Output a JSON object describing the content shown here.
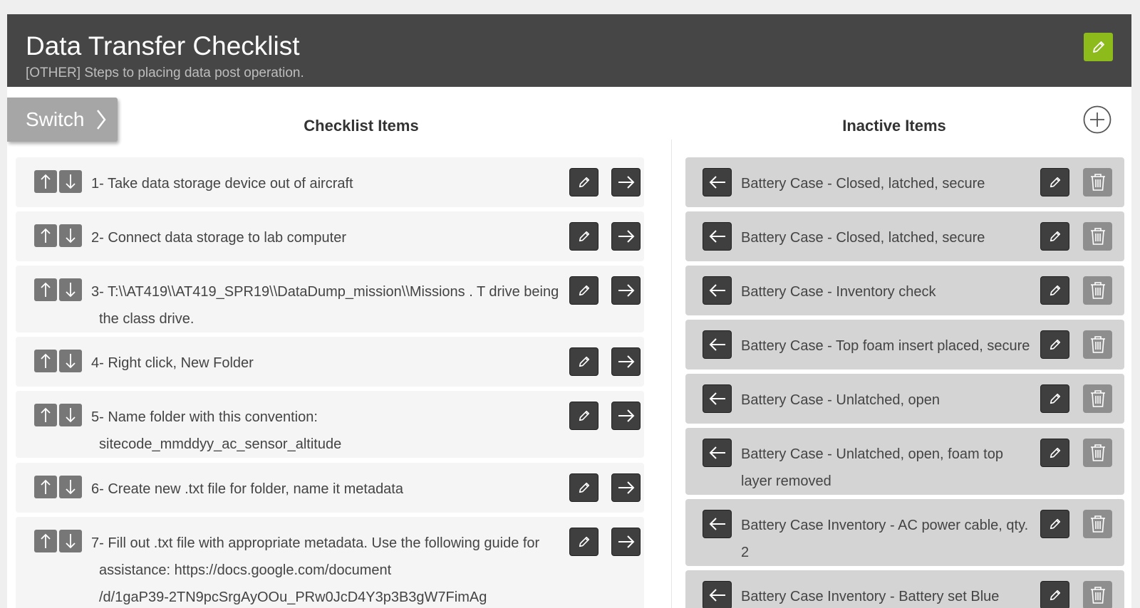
{
  "header": {
    "title": "Data Transfer Checklist",
    "subtitle": "[OTHER] Steps to placing data post operation."
  },
  "switch_label": "Switch",
  "columns": {
    "active_title": "Checklist Items",
    "inactive_title": "Inactive Items"
  },
  "checklist_items": [
    {
      "line1": "1- Take data storage device out of aircraft",
      "line2": ""
    },
    {
      "line1": "2- Connect data storage to lab computer",
      "line2": ""
    },
    {
      "line1": "3- T:\\\\AT419\\\\AT419_SPR19\\\\DataDump_mission\\\\Missions . T drive being",
      "line2": "the class drive."
    },
    {
      "line1": "4- Right click, New Folder",
      "line2": ""
    },
    {
      "line1": "5- Name folder with this convention:",
      "line2": "sitecode_mmddyy_ac_sensor_altitude"
    },
    {
      "line1": "6- Create new .txt file for folder, name it metadata",
      "line2": ""
    },
    {
      "line1": "7- Fill out .txt file with appropriate metadata. Use the following guide for",
      "line2": "assistance: https://docs.google.com/document",
      "line3": "/d/1gaP39-2TN9pcSrgAyOOu_PRw0JcD4Y3p3B3gW7FimAg"
    }
  ],
  "inactive_items": [
    {
      "line1": "Battery Case - Closed, latched, secure",
      "line2": ""
    },
    {
      "line1": "Battery Case - Closed, latched, secure",
      "line2": ""
    },
    {
      "line1": "Battery Case - Inventory check",
      "line2": ""
    },
    {
      "line1": "Battery Case - Top foam insert placed, secure",
      "line2": ""
    },
    {
      "line1": "Battery Case - Unlatched, open",
      "line2": ""
    },
    {
      "line1": "Battery Case - Unlatched, open, foam top",
      "line2": "layer removed"
    },
    {
      "line1": "Battery Case Inventory - AC power cable, qty.",
      "line2": "2"
    },
    {
      "line1": "Battery Case Inventory - Battery set Blue",
      "line2": ""
    }
  ],
  "colors": {
    "header_bg": "#464646",
    "accent_green": "#8dbb1c",
    "dark_button": "#3f3f3f",
    "gray_button": "#777777"
  }
}
